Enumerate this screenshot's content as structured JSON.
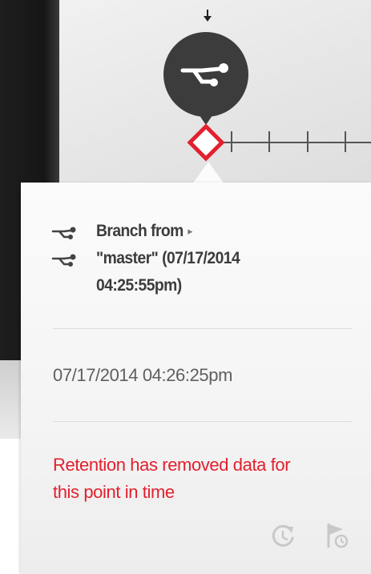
{
  "timeline": {
    "node_icon": "branch-icon",
    "marker_icon": "diamond-marker-icon",
    "arrow_icon": "down-arrow-icon",
    "marker_color": "#e2202e"
  },
  "popup": {
    "branch_label_line1": "Branch from",
    "branch_label_line2": "\"master\" (07/17/2014",
    "branch_label_line3": "04:25:55pm)",
    "branch_icon": "branch-icon",
    "expand_icon": "caret-right-icon",
    "timestamp": "07/17/2014 04:26:25pm",
    "retention_line1": "Retention has removed data for",
    "retention_line2": "this point in time",
    "retention_color": "#e2202e",
    "actions": [
      {
        "icon": "restore-history-icon"
      },
      {
        "icon": "flag-icon"
      }
    ]
  }
}
